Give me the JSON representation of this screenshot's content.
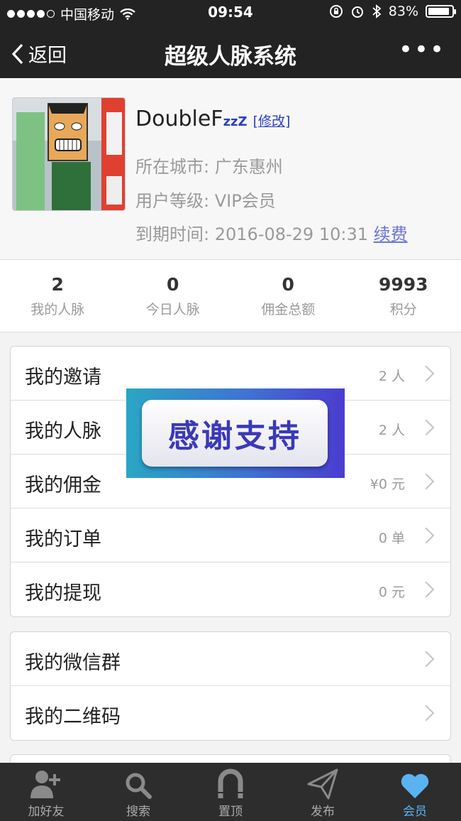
{
  "status_bar": {
    "carrier": "中国移动",
    "time": "09:54",
    "battery": "83%",
    "battery_level": 0.83
  },
  "nav": {
    "back_label": "返回",
    "title": "超级人脉系统",
    "more_label": "•••"
  },
  "profile": {
    "name": "DoubleF",
    "name_suffix": "zzZ",
    "edit_label": "[修改]",
    "city": "所在城市: 广东惠州",
    "level": "用户等级: VIP会员",
    "expiry": "到期时间: 2016-08-29 10:31",
    "renew_label": "续费"
  },
  "stats": [
    {
      "value": "2",
      "label": "我的人脉"
    },
    {
      "value": "0",
      "label": "今日人脉"
    },
    {
      "value": "0",
      "label": "佣金总额"
    },
    {
      "value": "9993",
      "label": "积分"
    }
  ],
  "menu_group_1": [
    {
      "label": "我的邀请",
      "value": "2 人"
    },
    {
      "label": "我的人脉",
      "value": "2 人"
    },
    {
      "label": "我的佣金",
      "value": "¥0 元"
    },
    {
      "label": "我的订单",
      "value": "0 单"
    },
    {
      "label": "我的提现",
      "value": "0 元"
    }
  ],
  "menu_group_2": [
    {
      "label": "我的微信群",
      "value": ""
    },
    {
      "label": "我的二维码",
      "value": ""
    }
  ],
  "banner": {
    "text": "感谢支持"
  },
  "tabbar": [
    {
      "label": "加好友",
      "icon": "add-friend-icon"
    },
    {
      "label": "搜索",
      "icon": "search-icon"
    },
    {
      "label": "置顶",
      "icon": "magnet-icon"
    },
    {
      "label": "发布",
      "icon": "paper-plane-icon"
    },
    {
      "label": "会员",
      "icon": "heart-icon",
      "active": true
    }
  ],
  "colors": {
    "nav_bg": "#232323",
    "link_blue": "#2a3fbf",
    "renew": "#6b73d9",
    "tab_active": "#5ab3f0",
    "tab_bg": "#2d2d2d"
  }
}
